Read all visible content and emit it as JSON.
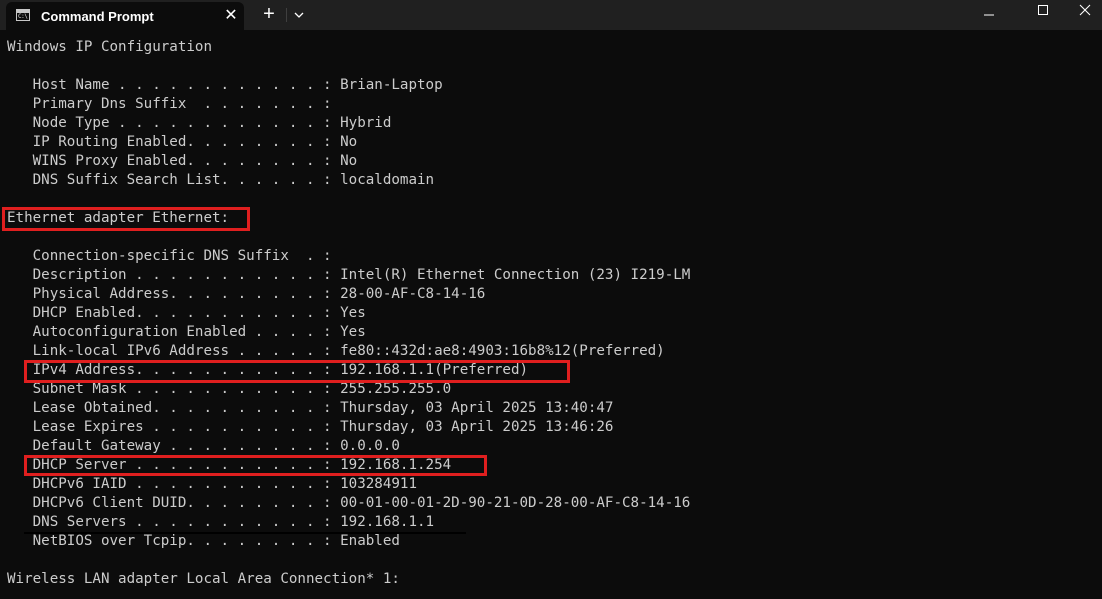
{
  "window": {
    "tab_title": "Command Prompt",
    "tab_icon": "cmd-icon",
    "tab_icon_text": "C:\\",
    "close_tab_label": "✕",
    "new_tab_label": "+",
    "dropdown_icon": "chevron-down-icon",
    "controls": [
      "minimize-icon",
      "maximize-icon",
      "close-icon"
    ]
  },
  "terminal": {
    "lines": [
      "Windows IP Configuration",
      "",
      "   Host Name . . . . . . . . . . . . : Brian-Laptop",
      "   Primary Dns Suffix  . . . . . . . :",
      "   Node Type . . . . . . . . . . . . : Hybrid",
      "   IP Routing Enabled. . . . . . . . : No",
      "   WINS Proxy Enabled. . . . . . . . : No",
      "   DNS Suffix Search List. . . . . . : localdomain",
      "",
      "Ethernet adapter Ethernet:",
      "",
      "   Connection-specific DNS Suffix  . :",
      "   Description . . . . . . . . . . . : Intel(R) Ethernet Connection (23) I219-LM",
      "   Physical Address. . . . . . . . . : 28-00-AF-C8-14-16",
      "   DHCP Enabled. . . . . . . . . . . : Yes",
      "   Autoconfiguration Enabled . . . . : Yes",
      "   Link-local IPv6 Address . . . . . : fe80::432d:ae8:4903:16b8%12(Preferred)",
      "   IPv4 Address. . . . . . . . . . . : 192.168.1.1(Preferred)",
      "   Subnet Mask . . . . . . . . . . . : 255.255.255.0",
      "   Lease Obtained. . . . . . . . . . : Thursday, 03 April 2025 13:40:47",
      "   Lease Expires . . . . . . . . . . : Thursday, 03 April 2025 13:46:26",
      "   Default Gateway . . . . . . . . . : 0.0.0.0",
      "   DHCP Server . . . . . . . . . . . : 192.168.1.254",
      "   DHCPv6 IAID . . . . . . . . . . . : 103284911",
      "   DHCPv6 Client DUID. . . . . . . . : 00-01-00-01-2D-90-21-0D-28-00-AF-C8-14-16",
      "   DNS Servers . . . . . . . . . . . : 192.168.1.1",
      "   NetBIOS over Tcpip. . . . . . . . : Enabled",
      "",
      "Wireless LAN adapter Local Area Connection* 1:"
    ],
    "highlight_color": "#e01f1f",
    "text_color": "#cccccc",
    "background": "#0c0c0c"
  }
}
